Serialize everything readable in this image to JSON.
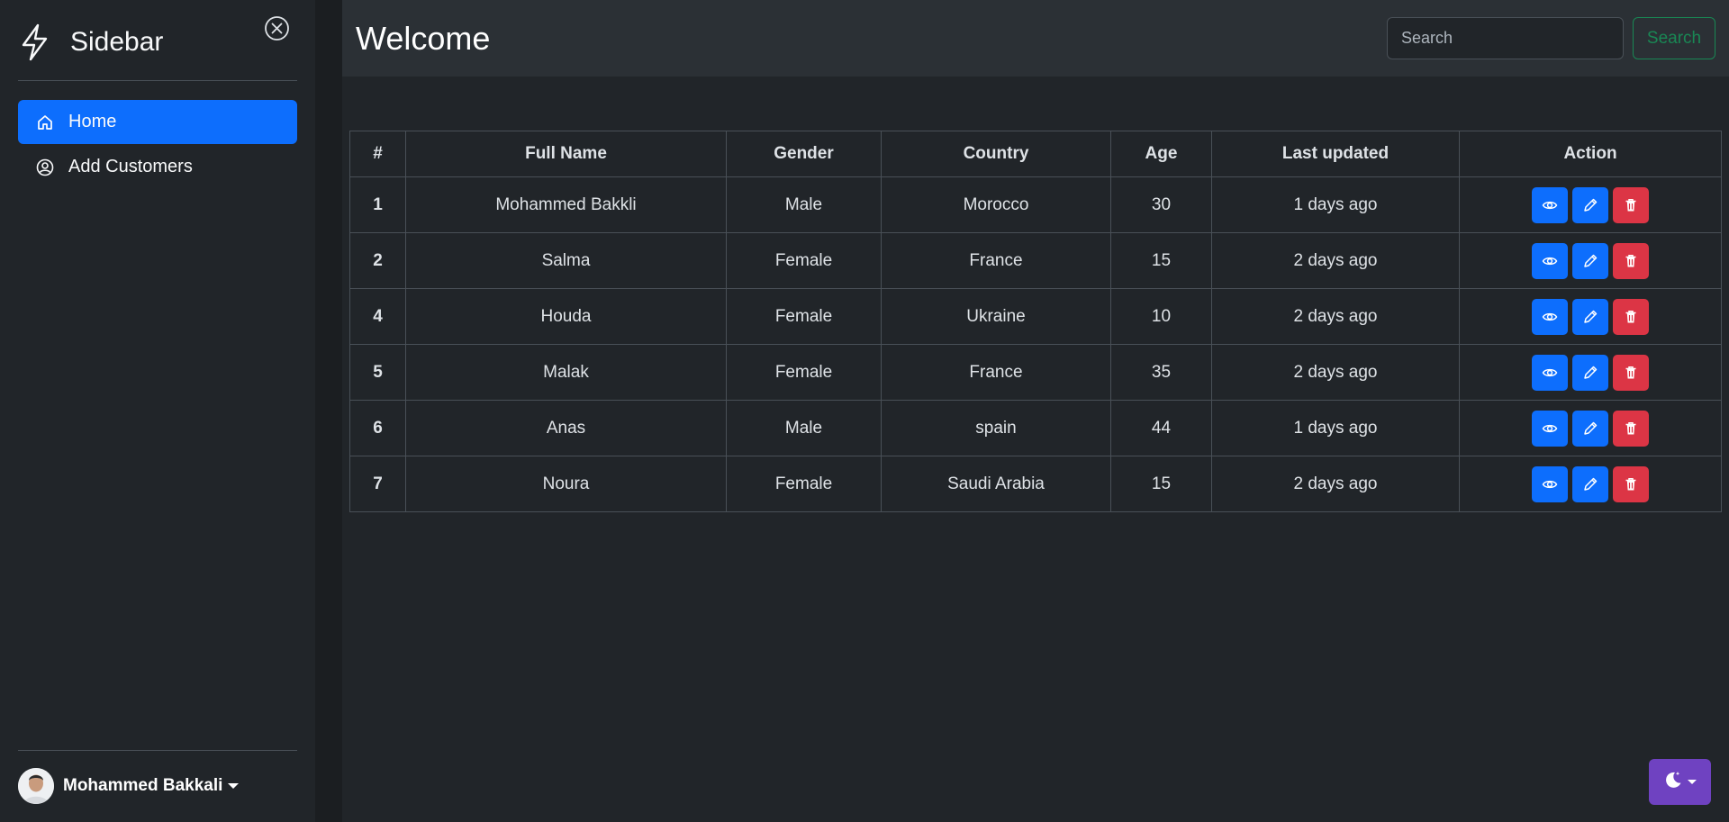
{
  "sidebar": {
    "title": "Sidebar",
    "brand_icon": "lightning-icon",
    "close_icon": "close-circle-icon",
    "items": [
      {
        "label": "Home",
        "icon": "house-icon",
        "active": true
      },
      {
        "label": "Add Customers",
        "icon": "person-circle-icon",
        "active": false
      }
    ],
    "user": {
      "name": "Mohammed Bakkali"
    }
  },
  "header": {
    "title": "Welcome",
    "search_placeholder": "Search",
    "search_button": "Search"
  },
  "table": {
    "columns": [
      "#",
      "Full Name",
      "Gender",
      "Country",
      "Age",
      "Last updated",
      "Action"
    ],
    "rows": [
      {
        "id": "1",
        "name": "Mohammed Bakkli",
        "gender": "Male",
        "country": "Morocco",
        "age": "30",
        "updated": "1 days ago"
      },
      {
        "id": "2",
        "name": "Salma",
        "gender": "Female",
        "country": "France",
        "age": "15",
        "updated": "2 days ago"
      },
      {
        "id": "4",
        "name": "Houda",
        "gender": "Female",
        "country": "Ukraine",
        "age": "10",
        "updated": "2 days ago"
      },
      {
        "id": "5",
        "name": "Malak",
        "gender": "Female",
        "country": "France",
        "age": "35",
        "updated": "2 days ago"
      },
      {
        "id": "6",
        "name": "Anas",
        "gender": "Male",
        "country": "spain",
        "age": "44",
        "updated": "1 days ago"
      },
      {
        "id": "7",
        "name": "Noura",
        "gender": "Female",
        "country": "Saudi Arabia",
        "age": "15",
        "updated": "2 days ago"
      }
    ],
    "action_icons": [
      "eye-icon",
      "pencil-icon",
      "trash-icon"
    ]
  },
  "theme_toggle": {
    "icon": "moon-stars-icon"
  },
  "colors": {
    "primary": "#0d6efd",
    "danger": "#dc3545",
    "success": "#198754",
    "theme_button": "#6f42c1",
    "background": "#212529",
    "topbar": "#2b3035"
  }
}
